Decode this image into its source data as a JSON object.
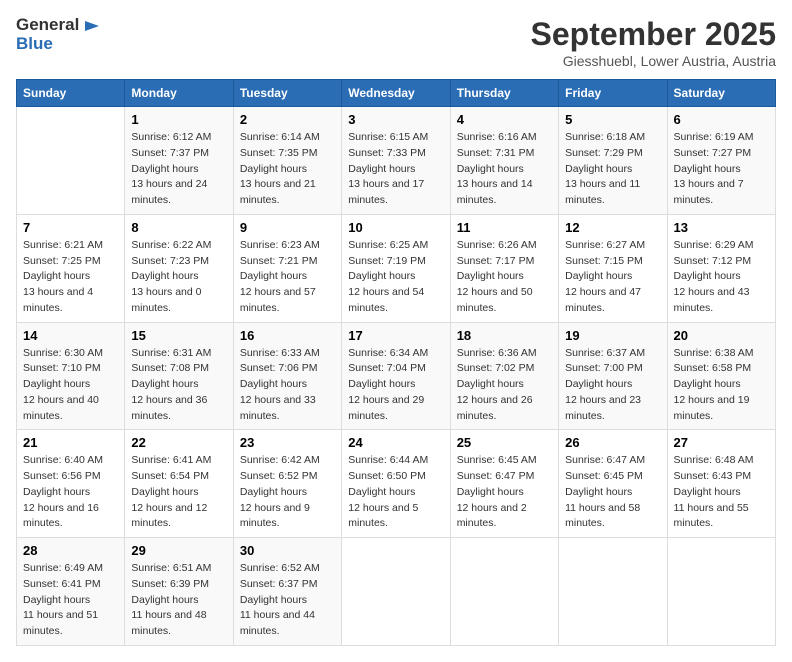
{
  "logo": {
    "line1": "General",
    "line2": "Blue"
  },
  "title": "September 2025",
  "location": "Giesshuebl, Lower Austria, Austria",
  "days_of_week": [
    "Sunday",
    "Monday",
    "Tuesday",
    "Wednesday",
    "Thursday",
    "Friday",
    "Saturday"
  ],
  "weeks": [
    [
      {
        "day": "",
        "sunrise": "",
        "sunset": "",
        "daylight": ""
      },
      {
        "day": "1",
        "sunrise": "6:12 AM",
        "sunset": "7:37 PM",
        "daylight": "13 hours and 24 minutes."
      },
      {
        "day": "2",
        "sunrise": "6:14 AM",
        "sunset": "7:35 PM",
        "daylight": "13 hours and 21 minutes."
      },
      {
        "day": "3",
        "sunrise": "6:15 AM",
        "sunset": "7:33 PM",
        "daylight": "13 hours and 17 minutes."
      },
      {
        "day": "4",
        "sunrise": "6:16 AM",
        "sunset": "7:31 PM",
        "daylight": "13 hours and 14 minutes."
      },
      {
        "day": "5",
        "sunrise": "6:18 AM",
        "sunset": "7:29 PM",
        "daylight": "13 hours and 11 minutes."
      },
      {
        "day": "6",
        "sunrise": "6:19 AM",
        "sunset": "7:27 PM",
        "daylight": "13 hours and 7 minutes."
      }
    ],
    [
      {
        "day": "7",
        "sunrise": "6:21 AM",
        "sunset": "7:25 PM",
        "daylight": "13 hours and 4 minutes."
      },
      {
        "day": "8",
        "sunrise": "6:22 AM",
        "sunset": "7:23 PM",
        "daylight": "13 hours and 0 minutes."
      },
      {
        "day": "9",
        "sunrise": "6:23 AM",
        "sunset": "7:21 PM",
        "daylight": "12 hours and 57 minutes."
      },
      {
        "day": "10",
        "sunrise": "6:25 AM",
        "sunset": "7:19 PM",
        "daylight": "12 hours and 54 minutes."
      },
      {
        "day": "11",
        "sunrise": "6:26 AM",
        "sunset": "7:17 PM",
        "daylight": "12 hours and 50 minutes."
      },
      {
        "day": "12",
        "sunrise": "6:27 AM",
        "sunset": "7:15 PM",
        "daylight": "12 hours and 47 minutes."
      },
      {
        "day": "13",
        "sunrise": "6:29 AM",
        "sunset": "7:12 PM",
        "daylight": "12 hours and 43 minutes."
      }
    ],
    [
      {
        "day": "14",
        "sunrise": "6:30 AM",
        "sunset": "7:10 PM",
        "daylight": "12 hours and 40 minutes."
      },
      {
        "day": "15",
        "sunrise": "6:31 AM",
        "sunset": "7:08 PM",
        "daylight": "12 hours and 36 minutes."
      },
      {
        "day": "16",
        "sunrise": "6:33 AM",
        "sunset": "7:06 PM",
        "daylight": "12 hours and 33 minutes."
      },
      {
        "day": "17",
        "sunrise": "6:34 AM",
        "sunset": "7:04 PM",
        "daylight": "12 hours and 29 minutes."
      },
      {
        "day": "18",
        "sunrise": "6:36 AM",
        "sunset": "7:02 PM",
        "daylight": "12 hours and 26 minutes."
      },
      {
        "day": "19",
        "sunrise": "6:37 AM",
        "sunset": "7:00 PM",
        "daylight": "12 hours and 23 minutes."
      },
      {
        "day": "20",
        "sunrise": "6:38 AM",
        "sunset": "6:58 PM",
        "daylight": "12 hours and 19 minutes."
      }
    ],
    [
      {
        "day": "21",
        "sunrise": "6:40 AM",
        "sunset": "6:56 PM",
        "daylight": "12 hours and 16 minutes."
      },
      {
        "day": "22",
        "sunrise": "6:41 AM",
        "sunset": "6:54 PM",
        "daylight": "12 hours and 12 minutes."
      },
      {
        "day": "23",
        "sunrise": "6:42 AM",
        "sunset": "6:52 PM",
        "daylight": "12 hours and 9 minutes."
      },
      {
        "day": "24",
        "sunrise": "6:44 AM",
        "sunset": "6:50 PM",
        "daylight": "12 hours and 5 minutes."
      },
      {
        "day": "25",
        "sunrise": "6:45 AM",
        "sunset": "6:47 PM",
        "daylight": "12 hours and 2 minutes."
      },
      {
        "day": "26",
        "sunrise": "6:47 AM",
        "sunset": "6:45 PM",
        "daylight": "11 hours and 58 minutes."
      },
      {
        "day": "27",
        "sunrise": "6:48 AM",
        "sunset": "6:43 PM",
        "daylight": "11 hours and 55 minutes."
      }
    ],
    [
      {
        "day": "28",
        "sunrise": "6:49 AM",
        "sunset": "6:41 PM",
        "daylight": "11 hours and 51 minutes."
      },
      {
        "day": "29",
        "sunrise": "6:51 AM",
        "sunset": "6:39 PM",
        "daylight": "11 hours and 48 minutes."
      },
      {
        "day": "30",
        "sunrise": "6:52 AM",
        "sunset": "6:37 PM",
        "daylight": "11 hours and 44 minutes."
      },
      {
        "day": "",
        "sunrise": "",
        "sunset": "",
        "daylight": ""
      },
      {
        "day": "",
        "sunrise": "",
        "sunset": "",
        "daylight": ""
      },
      {
        "day": "",
        "sunrise": "",
        "sunset": "",
        "daylight": ""
      },
      {
        "day": "",
        "sunrise": "",
        "sunset": "",
        "daylight": ""
      }
    ]
  ]
}
